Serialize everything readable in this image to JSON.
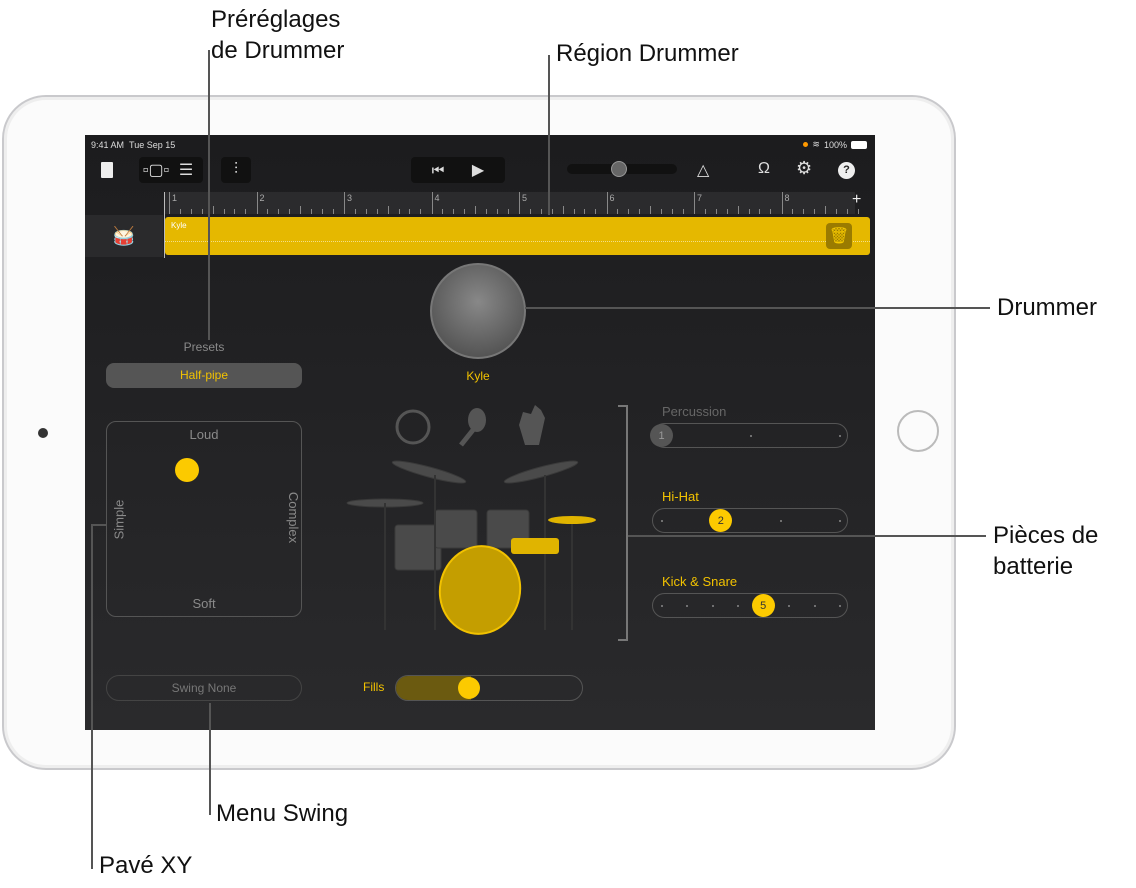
{
  "callouts": {
    "presets_line1": "Préréglages",
    "presets_line2": "de Drummer",
    "region": "Région Drummer",
    "drummer": "Drummer",
    "pieces_line1": "Pièces de",
    "pieces_line2": "batterie",
    "swing": "Menu Swing",
    "xy": "Pavé XY"
  },
  "status": {
    "time": "9:41 AM",
    "date": "Tue Sep 15",
    "battery": "100%"
  },
  "toolbar": {
    "icons": [
      "document-icon",
      "tracks-view-icon",
      "list-view-icon",
      "mixer-icon",
      "go-to-start-icon",
      "play-icon",
      "metronome-icon",
      "loop-icon",
      "settings-icon",
      "help-icon"
    ],
    "add": "+"
  },
  "ruler": {
    "bars": [
      "1",
      "2",
      "3",
      "4",
      "5",
      "6",
      "7",
      "8"
    ]
  },
  "region": {
    "name": "Kyle",
    "color": "#e5b800"
  },
  "drummer": {
    "name": "Kyle"
  },
  "presets": {
    "label": "Presets",
    "selected": "Half-pipe"
  },
  "xy_pad": {
    "top": "Loud",
    "bottom": "Soft",
    "left": "Simple",
    "right": "Complex"
  },
  "swing": {
    "value": "Swing None"
  },
  "fills": {
    "label": "Fills",
    "level": 0.35
  },
  "pieces": [
    {
      "name": "Percussion",
      "value": "1",
      "active": false,
      "positions": 3
    },
    {
      "name": "Hi-Hat",
      "value": "2",
      "active": true,
      "positions": 4
    },
    {
      "name": "Kick & Snare",
      "value": "5",
      "active": true,
      "positions": 8
    }
  ],
  "colors": {
    "accent": "#fcca00",
    "background": "#1c1c1e"
  }
}
